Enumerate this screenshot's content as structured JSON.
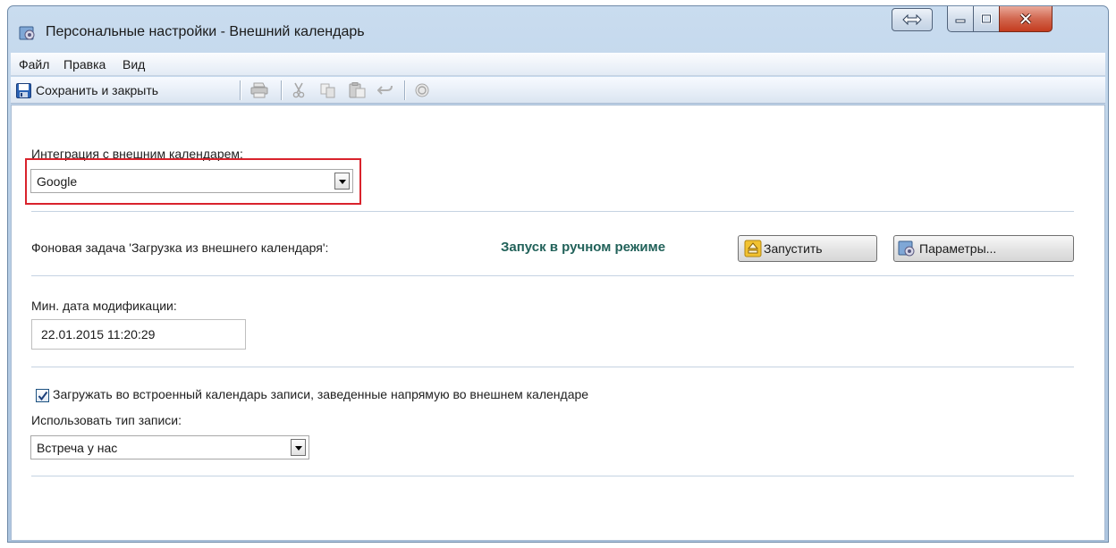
{
  "window": {
    "title": "Персональные настройки - Внешний календарь"
  },
  "menu": {
    "items": [
      "Файл",
      "Правка",
      "Вид"
    ]
  },
  "toolbar": {
    "save_label": "Сохранить и закрыть"
  },
  "integration": {
    "label": "Интеграция с внешним календарем:",
    "selected": "Google"
  },
  "background_task": {
    "label": "Фоновая задача 'Загрузка из внешнего календаря':",
    "status": "Запуск в ручном режиме",
    "start_label": "Запустить",
    "params_label": "Параметры..."
  },
  "modification": {
    "label": "Мин. дата модификации:",
    "value": "22.01.2015 11:20:29"
  },
  "import_option": {
    "label": "Загружать во встроенный календарь записи, заведенные напрямую во внешнем календаре",
    "checked": true
  },
  "record_type": {
    "label": "Использовать тип записи:",
    "selected": "Встреча у нас"
  },
  "colors": {
    "status_text": "#22625a",
    "highlight": "#d9232c"
  }
}
